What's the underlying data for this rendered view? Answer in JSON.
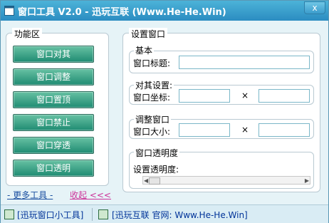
{
  "window": {
    "title": "窗口工具 V2.0 - 迅玩互联 (Www.He-He.Win)",
    "close": "x"
  },
  "function_panel": {
    "title": "功能区",
    "buttons": [
      "窗口对其",
      "窗口调整",
      "窗口置顶",
      "窗口禁止",
      "窗口穿透",
      "窗口透明"
    ],
    "more_link": "- 更多工具 -",
    "collapse_link": "收起 <<<"
  },
  "settings": {
    "title": "设置窗口",
    "basic": {
      "title": "基本",
      "window_title_label": "窗口标题:",
      "window_title_value": ""
    },
    "align": {
      "title": "对其设置:",
      "coord_label": "窗口坐标:",
      "x_value": "",
      "y_value": "",
      "times": "×"
    },
    "resize": {
      "title": "调整窗口",
      "size_label": "窗口大小:",
      "w_value": "",
      "h_value": "",
      "times": "×"
    },
    "opacity": {
      "title": "窗口透明度",
      "label": "设置透明度:",
      "left_arrow": "◀",
      "right_arrow": "▶"
    }
  },
  "statusbar": {
    "left": "[迅玩窗口小工具]",
    "right": "[迅玩互联 官网: Www.He-He.Win]"
  },
  "colors": {
    "titlebar": "#2b8cc1",
    "button": "#1f8b72",
    "more_link": "#1a4fa0",
    "collapse_link": "#cc3399"
  }
}
